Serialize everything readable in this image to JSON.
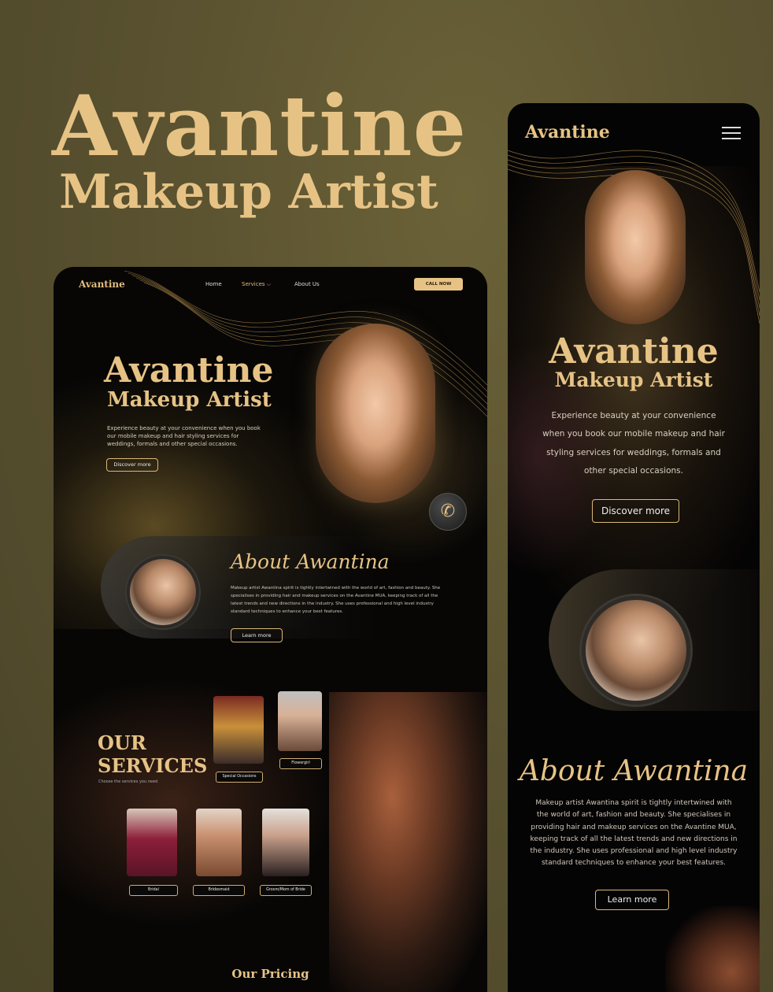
{
  "title": {
    "line1": "Avantine",
    "line2": "Makeup Artist"
  },
  "desktop": {
    "logo": "Avantine",
    "nav": {
      "home": "Home",
      "services": "Services ⌵",
      "about": "About Us",
      "call": "CALL NOW"
    },
    "hero": {
      "title": "Avantine",
      "subtitle": "Makeup Artist",
      "description": "Experience beauty at your convenience when you book our mobile makeup and hair styling services for weddings, formals and other special occasions.",
      "button": "Discover more"
    },
    "about": {
      "title": "About Awantina",
      "text": "Makeup artist Awantina spirit is tightly intertwined with the world of art, fashion and beauty. She specialises in providing hair and makeup services on the Avantine MUA, keeping track of all the latest trends and new directions in the industry. She uses professional and high level industry standard techniques to enhance your best features.",
      "button": "Learn more"
    },
    "services": {
      "title_line1": "OUR",
      "title_line2": "SERVICES",
      "subtitle": "Choose the services you need",
      "items": [
        "Special Occasions",
        "Flowergirl",
        "Bridal",
        "Bridesmaid",
        "Groom/Mom of Bride"
      ]
    },
    "pricing": "Our Pricing"
  },
  "mobile": {
    "logo": "Avantine",
    "hero": {
      "title": "Avantine",
      "subtitle": "Makeup Artist",
      "description": "Experience beauty at your convenience when you book our mobile makeup and hair styling services for weddings, formals and other special occasions.",
      "button": "Discover more"
    },
    "about": {
      "title": "About Awantina",
      "text": "Makeup artist Awantina spirit is tightly intertwined with the world of art, fashion and beauty. She specialises in providing hair and makeup services on the Avantine MUA, keeping track of all the latest trends and new directions in the industry. She uses professional and high level industry standard techniques to enhance your best features.",
      "button": "Learn more"
    }
  },
  "colors": {
    "gold": "#e6c385",
    "background": "#5a5230",
    "dark": "#070605"
  }
}
